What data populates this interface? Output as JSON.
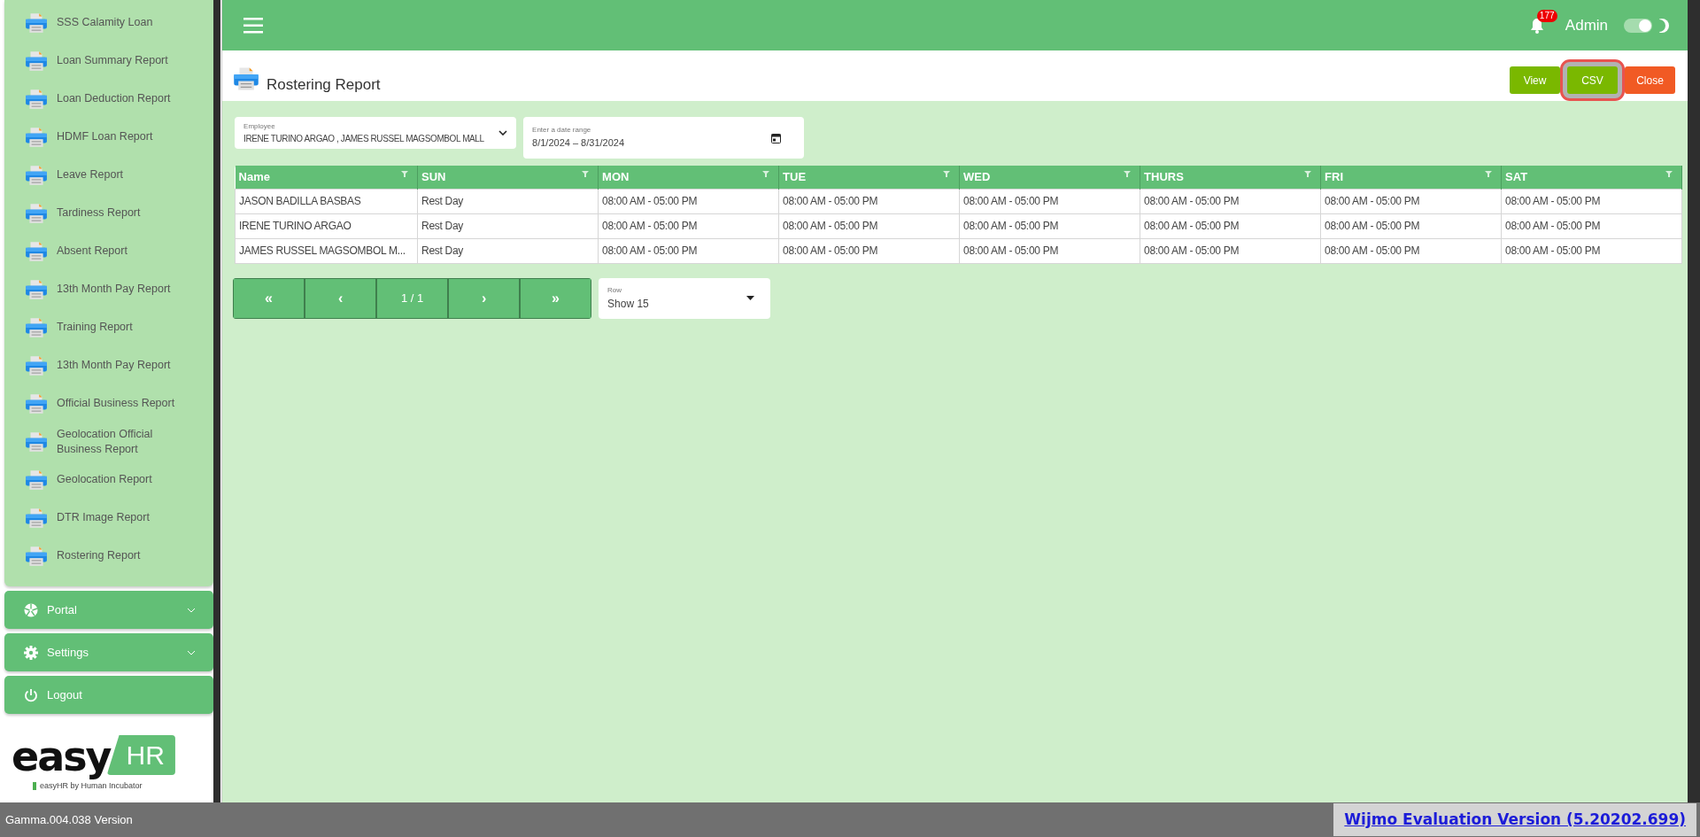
{
  "sidebar": {
    "items": [
      {
        "label": "SSS Calamity Loan"
      },
      {
        "label": "Loan Summary Report"
      },
      {
        "label": "Loan Deduction Report"
      },
      {
        "label": "HDMF Loan Report"
      },
      {
        "label": "Leave Report"
      },
      {
        "label": "Tardiness Report"
      },
      {
        "label": "Absent Report"
      },
      {
        "label": "13th Month Pay Report"
      },
      {
        "label": "Training Report"
      },
      {
        "label": "13th Month Pay Report"
      },
      {
        "label": "Official Business Report"
      },
      {
        "label": "Geolocation Official Business Report"
      },
      {
        "label": "Geolocation Report"
      },
      {
        "label": "DTR Image Report"
      },
      {
        "label": "Rostering Report"
      }
    ],
    "menu": [
      {
        "kind": "portal",
        "label": "Portal",
        "expanded": false
      },
      {
        "kind": "settings",
        "label": "Settings",
        "expanded": false
      },
      {
        "kind": "logout",
        "label": "Logout"
      }
    ],
    "logo": {
      "word": "easy",
      "badge": "HR",
      "tagline": "easyHR by Human Incubator"
    }
  },
  "header": {
    "notifications": "177",
    "user": "Admin",
    "dark_mode": {
      "on": true
    }
  },
  "page": {
    "title": "Rostering Report",
    "buttons": [
      {
        "kind": "view",
        "label": "View",
        "highlighted": false
      },
      {
        "kind": "csv",
        "label": "CSV",
        "highlighted": true
      },
      {
        "kind": "close",
        "label": "Close",
        "highlighted": false
      }
    ],
    "employee_field": {
      "label": "Employee",
      "value": "IRENE  TURINO ARGAO ,  JAMES RUSSEL MAGSOMBOL MALL"
    },
    "date_field": {
      "placeholder": "Enter a date range",
      "value": "8/1/2024 – 8/31/2024"
    }
  },
  "table": {
    "columns": [
      "Name",
      "SUN",
      "MON",
      "TUE",
      "WED",
      "THURS",
      "FRI",
      "SAT"
    ],
    "rows": [
      [
        "JASON BADILLA BASBAS",
        "Rest Day",
        "08:00 AM - 05:00 PM",
        "08:00 AM - 05:00 PM",
        "08:00 AM - 05:00 PM",
        "08:00 AM - 05:00 PM",
        "08:00 AM - 05:00 PM",
        "08:00 AM - 05:00 PM"
      ],
      [
        "IRENE TURINO ARGAO",
        "Rest Day",
        "08:00 AM - 05:00 PM",
        "08:00 AM - 05:00 PM",
        "08:00 AM - 05:00 PM",
        "08:00 AM - 05:00 PM",
        "08:00 AM - 05:00 PM",
        "08:00 AM - 05:00 PM"
      ],
      [
        "JAMES RUSSEL MAGSOMBOL M...",
        "Rest Day",
        "08:00 AM - 05:00 PM",
        "08:00 AM - 05:00 PM",
        "08:00 AM - 05:00 PM",
        "08:00 AM - 05:00 PM",
        "08:00 AM - 05:00 PM",
        "08:00 AM - 05:00 PM"
      ]
    ]
  },
  "pager": {
    "buttons": [
      "«",
      "‹",
      "1 / 1",
      "›",
      "»"
    ],
    "rows_field": {
      "label": "Row",
      "value": "Show 15"
    }
  },
  "status_bar": {
    "version": "Gamma.004.038 Version",
    "notice": "Wijmo Evaluation Version (5.20202.699)"
  }
}
